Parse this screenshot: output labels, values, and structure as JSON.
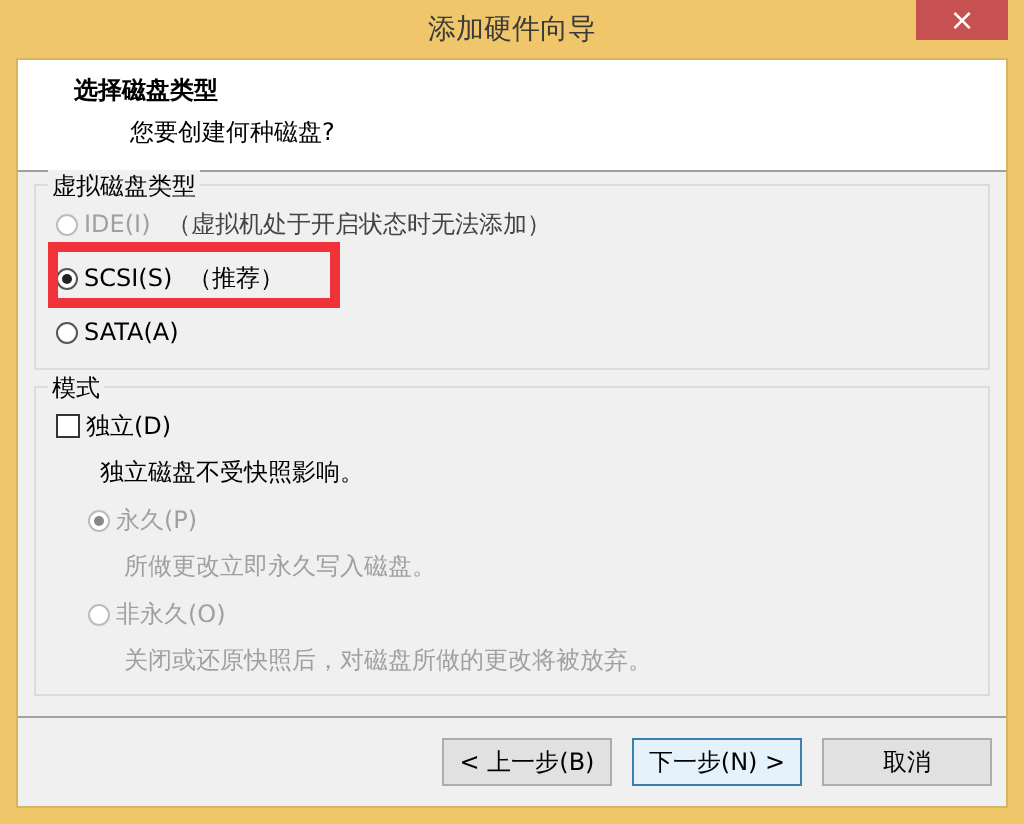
{
  "window": {
    "title": "添加硬件向导",
    "close": "×"
  },
  "header": {
    "title": "选择磁盘类型",
    "subtitle": "您要创建何种磁盘?"
  },
  "disk_type": {
    "legend": "虚拟磁盘类型",
    "options": [
      {
        "label": "IDE(I)",
        "note": "（虚拟机处于开启状态时无法添加）",
        "selected": false,
        "disabled": true,
        "highlighted": false
      },
      {
        "label": "SCSI(S)",
        "note": "（推荐）",
        "selected": true,
        "disabled": false,
        "highlighted": true
      },
      {
        "label": "SATA(A)",
        "selected": false,
        "disabled": false,
        "highlighted": false
      }
    ]
  },
  "mode": {
    "legend": "模式",
    "independent": {
      "label": "独立(D)",
      "checked": false
    },
    "description": "独立磁盘不受快照影响。",
    "options": [
      {
        "label": "永久(P)",
        "description": "所做更改立即永久写入磁盘。",
        "selected": true,
        "disabled": true
      },
      {
        "label": "非永久(O)",
        "description": "关闭或还原快照后，对磁盘所做的更改将被放弃。",
        "selected": false,
        "disabled": true
      }
    ]
  },
  "buttons": [
    {
      "label": "< 上一步(B)",
      "focused": false
    },
    {
      "label": "下一步(N) >",
      "focused": true
    },
    {
      "label": "取消",
      "focused": false
    }
  ]
}
